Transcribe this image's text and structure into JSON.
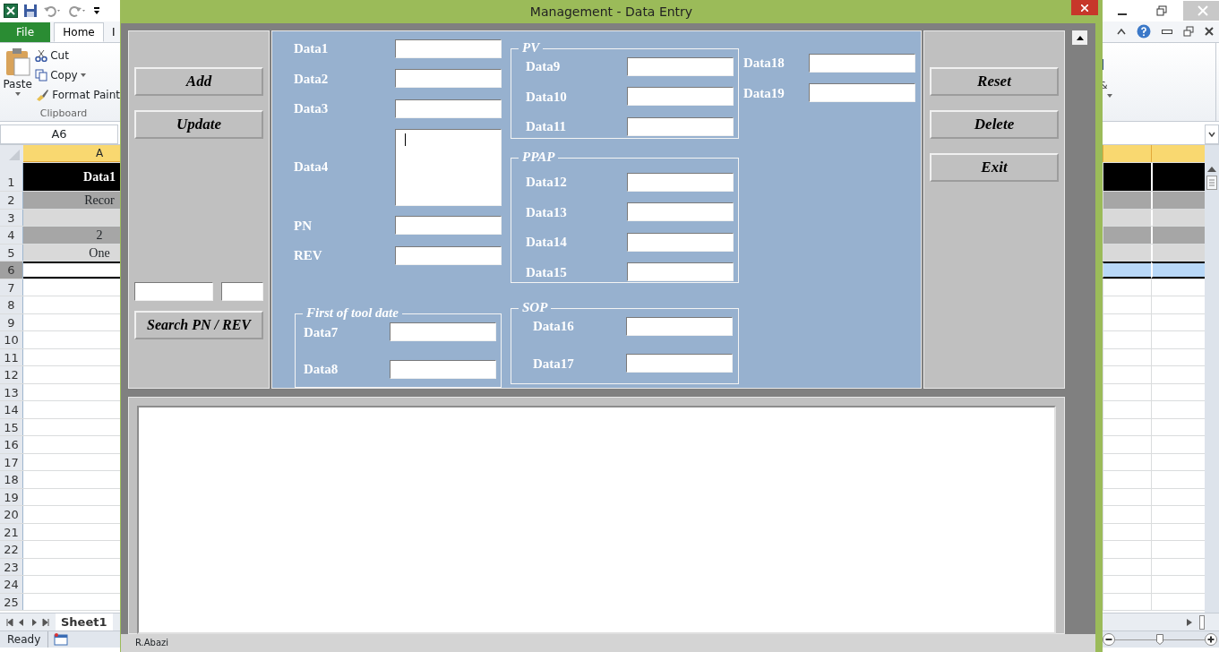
{
  "excel": {
    "ribbon_tabs": [
      {
        "label": "File",
        "selected": false
      },
      {
        "label": "Home",
        "selected": true
      },
      {
        "label": "I",
        "selected": false
      }
    ],
    "clipboard": {
      "paste": "Paste",
      "cut": "Cut",
      "copy": "Copy",
      "format_painter": "Format Paint",
      "group_label": "Clipboard"
    },
    "ribbon_fragment": "&",
    "name_box": "A6",
    "column_header": "A",
    "rows": [
      {
        "number": "1",
        "kind": "title",
        "text": "Data1",
        "selected": false
      },
      {
        "number": "2",
        "kind": "dark",
        "text": "Recor",
        "selected": false
      },
      {
        "number": "3",
        "kind": "light",
        "selected": false
      },
      {
        "number": "4",
        "kind": "dark",
        "text": "2",
        "selected": false
      },
      {
        "number": "5",
        "kind": "light",
        "text": "One",
        "selected": false
      },
      {
        "number": "6",
        "kind": "plain",
        "selected": true
      },
      {
        "number": "7",
        "kind": "plain",
        "selected": false
      },
      {
        "number": "8",
        "kind": "plain",
        "selected": false
      },
      {
        "number": "9",
        "kind": "plain",
        "selected": false
      },
      {
        "number": "10",
        "kind": "plain",
        "selected": false
      },
      {
        "number": "11",
        "kind": "plain",
        "selected": false
      },
      {
        "number": "12",
        "kind": "plain",
        "selected": false
      },
      {
        "number": "13",
        "kind": "plain",
        "selected": false
      },
      {
        "number": "14",
        "kind": "plain",
        "selected": false
      },
      {
        "number": "15",
        "kind": "plain",
        "selected": false
      },
      {
        "number": "16",
        "kind": "plain",
        "selected": false
      },
      {
        "number": "17",
        "kind": "plain",
        "selected": false
      },
      {
        "number": "18",
        "kind": "plain",
        "selected": false
      },
      {
        "number": "19",
        "kind": "plain",
        "selected": false
      },
      {
        "number": "20",
        "kind": "plain",
        "selected": false
      },
      {
        "number": "21",
        "kind": "plain",
        "selected": false
      },
      {
        "number": "22",
        "kind": "plain",
        "selected": false
      },
      {
        "number": "23",
        "kind": "plain",
        "selected": false
      },
      {
        "number": "24",
        "kind": "plain",
        "selected": false
      },
      {
        "number": "25",
        "kind": "plain",
        "selected": false
      }
    ],
    "sheet_tabs": [
      {
        "label": "Sheet1",
        "selected": true
      }
    ],
    "status": "Ready",
    "zoom_slider": {
      "level": 0.5
    }
  },
  "dialog": {
    "title": "Management - Data Entry",
    "left_buttons": [
      "Add",
      "Update"
    ],
    "search_button": "Search PN / REV",
    "right_buttons": [
      "Reset",
      "Delete",
      "Exit"
    ],
    "main_fields": [
      {
        "label": "Data1",
        "kind": "line",
        "focused": false
      },
      {
        "label": "Data2",
        "kind": "line",
        "focused": false
      },
      {
        "label": "Data3",
        "kind": "line",
        "focused": false
      },
      {
        "label": "Data4",
        "kind": "memo",
        "focused": true
      },
      {
        "label": "PN",
        "kind": "line",
        "focused": false
      },
      {
        "label": "REV",
        "kind": "line",
        "focused": false
      }
    ],
    "frames": [
      {
        "title": "First of tool date",
        "fields": [
          "Data7",
          "Data8"
        ]
      },
      {
        "title": "PV",
        "fields": [
          "Data9",
          "Data10",
          "Data11"
        ]
      },
      {
        "title": "PPAP",
        "fields": [
          "Data12",
          "Data13",
          "Data14",
          "Data15"
        ]
      },
      {
        "title": "SOP",
        "fields": [
          "Data16",
          "Data17"
        ]
      }
    ],
    "extra_fields": [
      "Data18",
      "Data19"
    ],
    "footer": "R.Abazi"
  }
}
